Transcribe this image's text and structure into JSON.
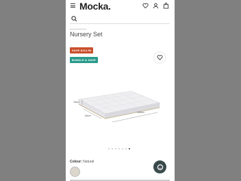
{
  "header": {
    "logo": "Mocka.",
    "icons": [
      "menu-icon",
      "heart-icon",
      "user-icon",
      "bag-icon"
    ]
  },
  "search": {
    "icon": "search-icon"
  },
  "page": {
    "title": "Nursery Set"
  },
  "badges": {
    "save": "SAVE $112.50",
    "bundle": "BUNDLE & SAVE"
  },
  "product": {
    "dims": {
      "height": "15cm",
      "width": "60cm",
      "length": "130cm"
    },
    "carousel": {
      "count": 7,
      "active": 6
    }
  },
  "colour": {
    "label": "Colour:",
    "value": "Natural",
    "swatch": "#ddd6cd"
  },
  "colors": {
    "save_badge": "#c9502c",
    "bundle_badge": "#2a9a8a",
    "chat": "#3a4a4c"
  }
}
